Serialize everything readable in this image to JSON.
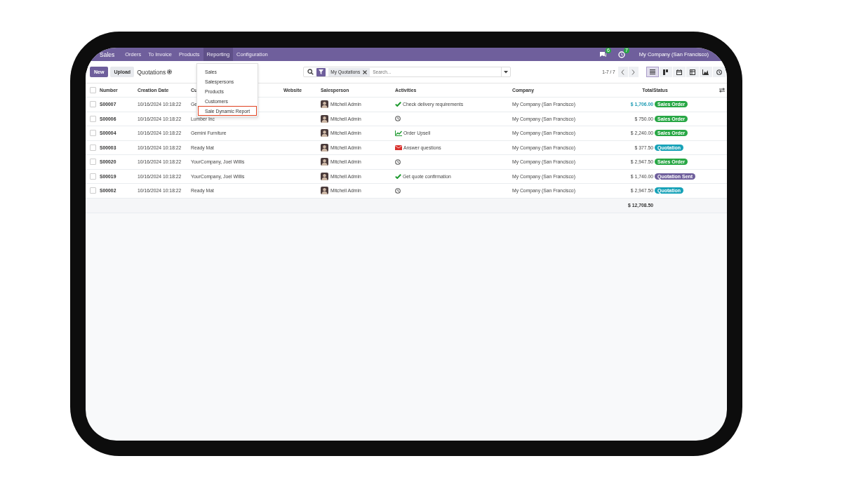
{
  "navbar": {
    "app": "Sales",
    "menu": [
      {
        "label": "Orders",
        "open": false
      },
      {
        "label": "To Invoice",
        "open": false
      },
      {
        "label": "Products",
        "open": false
      },
      {
        "label": "Reporting",
        "open": true
      },
      {
        "label": "Configuration",
        "open": false
      }
    ],
    "messages_count": "6",
    "activities_count": "7",
    "company": "My Company (San Francisco)"
  },
  "reporting_menu": [
    {
      "label": "Sales",
      "highlighted": false
    },
    {
      "label": "Salespersons",
      "highlighted": false
    },
    {
      "label": "Products",
      "highlighted": false
    },
    {
      "label": "Customers",
      "highlighted": false
    },
    {
      "label": "Sale Dynamic Report",
      "highlighted": true
    }
  ],
  "control_panel": {
    "new_button": "New",
    "upload_button": "Upload",
    "title": "Quotations",
    "facet": "My Quotations",
    "search_placeholder": "Search...",
    "pager": "1-7 / 7",
    "views": [
      {
        "kind": "list",
        "selected": true
      },
      {
        "kind": "kanban",
        "selected": false
      },
      {
        "kind": "calendar",
        "selected": false
      },
      {
        "kind": "pivot",
        "selected": false
      },
      {
        "kind": "graph",
        "selected": false
      },
      {
        "kind": "activity",
        "selected": false
      }
    ]
  },
  "table": {
    "columns": [
      "Number",
      "Creation Date",
      "Cu",
      "Website",
      "Salesperson",
      "Activities",
      "Company",
      "Total",
      "Status"
    ],
    "rows": [
      {
        "checked": false,
        "number": "S00007",
        "date": "10/16/2024 10:18:22",
        "customer": "Ge",
        "salesperson": "Mitchell Admin",
        "activity": {
          "kind": "check",
          "text": "Check delivery requirements"
        },
        "company": "My Company (San Francisco)",
        "total": "$ 1,706.00",
        "total_highlighted": true,
        "status": {
          "text": "Sales Order",
          "color": "#28a745"
        }
      },
      {
        "checked": false,
        "number": "S00006",
        "date": "10/16/2024 10:18:22",
        "customer": "Lumber Inc",
        "salesperson": "Mitchell Admin",
        "activity": {
          "kind": "clock"
        },
        "company": "My Company (San Francisco)",
        "total": "$ 750.00",
        "total_highlighted": false,
        "status": {
          "text": "Sales Order",
          "color": "#28a745"
        }
      },
      {
        "checked": false,
        "number": "S00004",
        "date": "10/16/2024 10:18:22",
        "customer": "Gemini Furniture",
        "salesperson": "Mitchell Admin",
        "activity": {
          "kind": "chart",
          "text": "Order Upsell"
        },
        "company": "My Company (San Francisco)",
        "total": "$ 2,240.00",
        "total_highlighted": false,
        "status": {
          "text": "Sales Order",
          "color": "#28a745"
        }
      },
      {
        "checked": false,
        "number": "S00003",
        "date": "10/16/2024 10:18:22",
        "customer": "Ready Mat",
        "salesperson": "Mitchell Admin",
        "activity": {
          "kind": "mail",
          "text": "Answer questions"
        },
        "company": "My Company (San Francisco)",
        "total": "$ 377.50",
        "total_highlighted": false,
        "status": {
          "text": "Quotation",
          "color": "#17a2b8"
        }
      },
      {
        "checked": false,
        "number": "S00020",
        "date": "10/16/2024 10:18:22",
        "customer": "YourCompany, Joel Willis",
        "salesperson": "Mitchell Admin",
        "activity": {
          "kind": "clock"
        },
        "company": "My Company (San Francisco)",
        "total": "$ 2,947.50",
        "total_highlighted": false,
        "status": {
          "text": "Sales Order",
          "color": "#28a745"
        }
      },
      {
        "checked": false,
        "number": "S00019",
        "date": "10/16/2024 10:18:22",
        "customer": "YourCompany, Joel Willis",
        "salesperson": "Mitchell Admin",
        "activity": {
          "kind": "check",
          "text": "Get quote confirmation"
        },
        "company": "My Company (San Francisco)",
        "total": "$ 1,740.00",
        "total_highlighted": false,
        "status": {
          "text": "Quotation Sent",
          "color": "#6f5f9c"
        }
      },
      {
        "checked": false,
        "number": "S00002",
        "date": "10/16/2024 10:18:22",
        "customer": "Ready Mat",
        "salesperson": "Mitchell Admin",
        "activity": {
          "kind": "clock"
        },
        "company": "My Company (San Francisco)",
        "total": "$ 2,947.50",
        "total_highlighted": false,
        "status": {
          "text": "Quotation",
          "color": "#17a2b8"
        }
      }
    ],
    "grand_total": "$ 12,708.50",
    "select_all_checked": false
  }
}
